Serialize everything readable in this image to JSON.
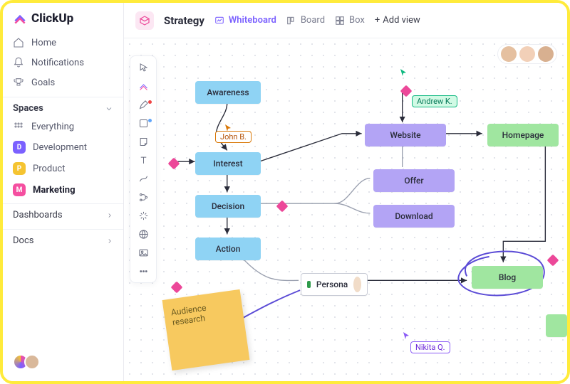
{
  "app": {
    "name": "ClickUp"
  },
  "sidebar": {
    "nav": [
      {
        "label": "Home",
        "icon": "home-icon"
      },
      {
        "label": "Notifications",
        "icon": "bell-icon"
      },
      {
        "label": "Goals",
        "icon": "trophy-icon"
      }
    ],
    "spaces_header": "Spaces",
    "everything_label": "Everything",
    "spaces": [
      {
        "label": "Development",
        "color": "#7B61FF",
        "letter": "D"
      },
      {
        "label": "Product",
        "color": "#F5C431",
        "letter": "P"
      },
      {
        "label": "Marketing",
        "color": "#F54FA0",
        "letter": "M",
        "active": true
      }
    ],
    "sections": [
      {
        "label": "Dashboards"
      },
      {
        "label": "Docs"
      }
    ]
  },
  "topbar": {
    "title": "Strategy",
    "tabs": [
      {
        "label": "Whiteboard",
        "icon": "whiteboard-icon",
        "active": true
      },
      {
        "label": "Board",
        "icon": "board-icon"
      },
      {
        "label": "Box",
        "icon": "box-icon"
      }
    ],
    "add_view": "Add view"
  },
  "palette": [
    "pointer-icon",
    "clickup-icon",
    "pen-icon",
    "square-icon",
    "note-icon",
    "text-icon",
    "connector-icon",
    "branch-icon",
    "magic-icon",
    "globe-icon",
    "image-icon",
    "more-icon"
  ],
  "palette_dots": {
    "pen-icon": "#EF4444",
    "square-icon": "#60A5FA"
  },
  "whiteboard": {
    "nodes": {
      "awareness": "Awareness",
      "interest": "Interest",
      "decision": "Decision",
      "action": "Action",
      "website": "Website",
      "offer": "Offer",
      "download": "Download",
      "homepage": "Homepage",
      "blog": "Blog",
      "persona": "Persona"
    },
    "sticky": "Audience research",
    "user_tags": {
      "john": "John B.",
      "andrew": "Andrew K.",
      "nikita": "Nikita Q."
    },
    "tag_colors": {
      "john": "#d97706",
      "andrew": "#10b981",
      "nikita": "#8b5cf6"
    }
  }
}
